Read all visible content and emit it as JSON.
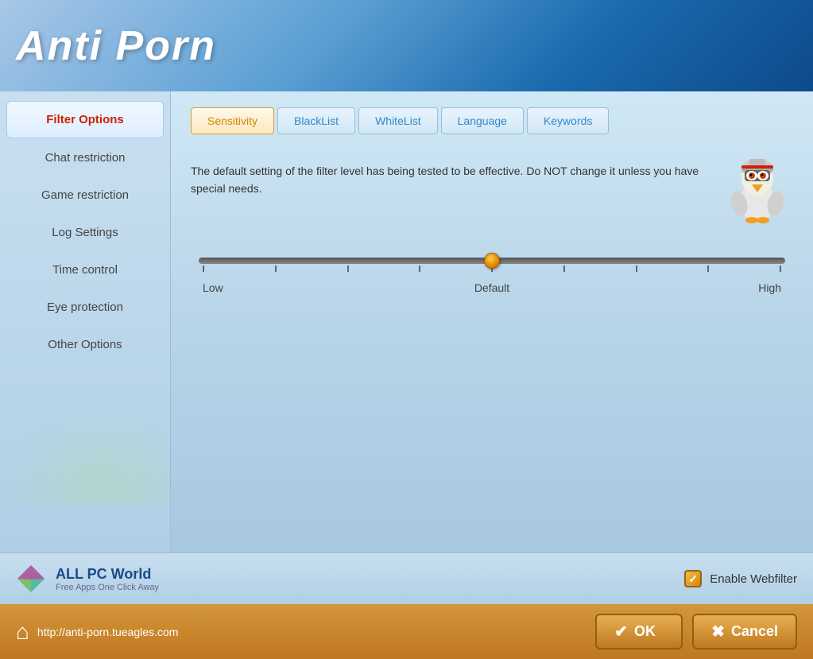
{
  "app": {
    "title": "Anti Porn"
  },
  "sidebar": {
    "items": [
      {
        "id": "filter-options",
        "label": "Filter Options",
        "active": true
      },
      {
        "id": "chat-restriction",
        "label": "Chat restriction",
        "active": false
      },
      {
        "id": "game-restriction",
        "label": "Game restriction",
        "active": false
      },
      {
        "id": "log-settings",
        "label": "Log Settings",
        "active": false
      },
      {
        "id": "time-control",
        "label": "Time control",
        "active": false
      },
      {
        "id": "eye-protection",
        "label": "Eye protection",
        "active": false
      },
      {
        "id": "other-options",
        "label": "Other Options",
        "active": false
      }
    ]
  },
  "tabs": [
    {
      "id": "sensitivity",
      "label": "Sensitivity",
      "active": true
    },
    {
      "id": "blacklist",
      "label": "BlackList",
      "active": false
    },
    {
      "id": "whitelist",
      "label": "WhiteList",
      "active": false
    },
    {
      "id": "language",
      "label": "Language",
      "active": false
    },
    {
      "id": "keywords",
      "label": "Keywords",
      "active": false
    }
  ],
  "info": {
    "text": "The default setting of the filter level has being tested to be effective. Do NOT change it unless you have special needs."
  },
  "slider": {
    "labels": {
      "low": "Low",
      "default": "Default",
      "high": "High"
    },
    "value": 50
  },
  "branding": {
    "name": "ALL PC World",
    "subtitle": "Free Apps One Click Away",
    "enable_webfilter_label": "Enable Webfilter"
  },
  "footer": {
    "url": "http://anti-porn.tueagles.com",
    "ok_label": "OK",
    "cancel_label": "Cancel"
  }
}
